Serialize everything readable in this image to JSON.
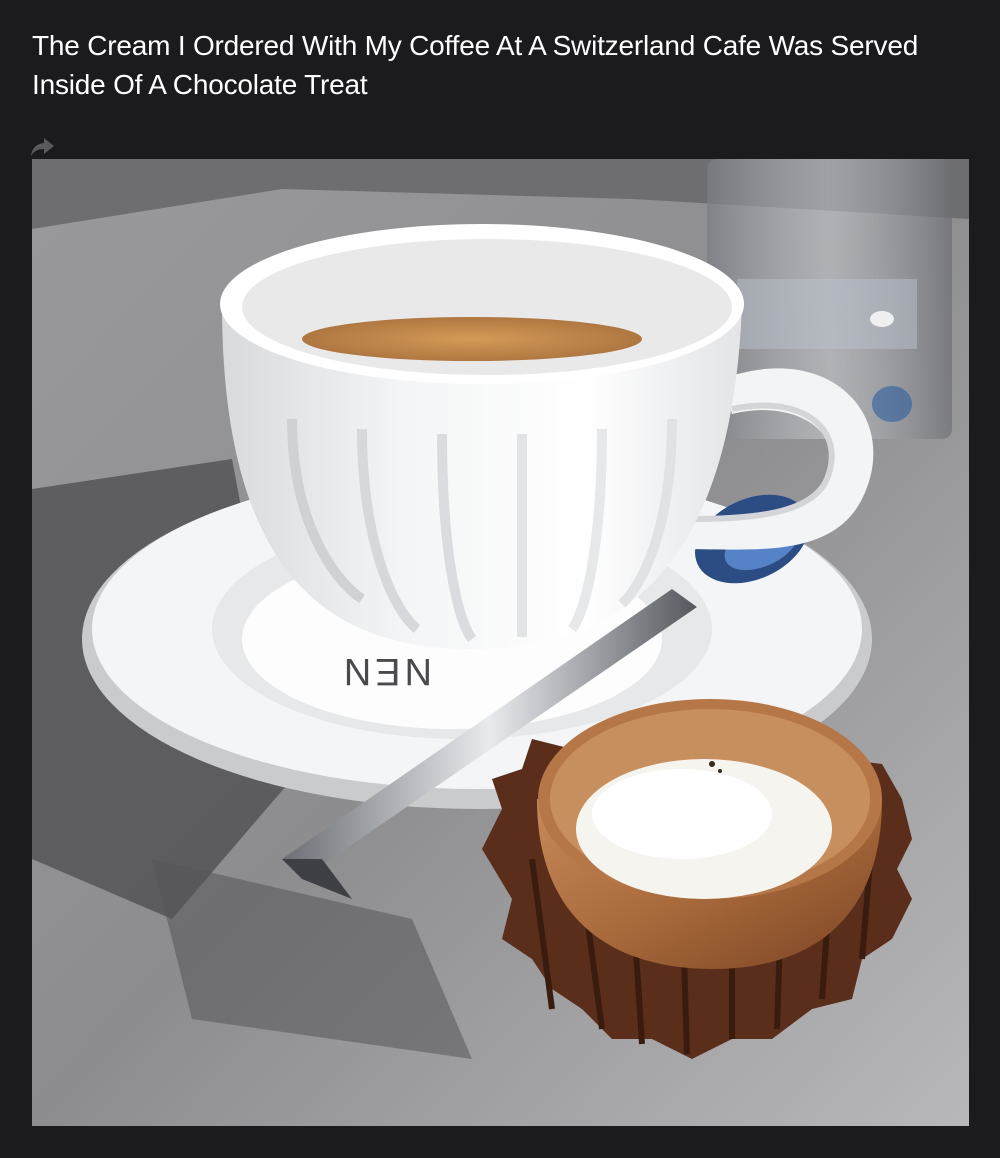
{
  "post": {
    "title": "The Cream I Ordered With My Coffee At A Switzerland Cafe Was Served Inside Of A Chocolate Treat",
    "share_icon": "share-arrow-icon"
  },
  "photo": {
    "subject": "coffee-cup-with-chocolate-cream-cup-photo"
  },
  "colors": {
    "background": "#1b1b1d",
    "title_text": "#ffffff",
    "share_icon": "#5a5a5e"
  }
}
